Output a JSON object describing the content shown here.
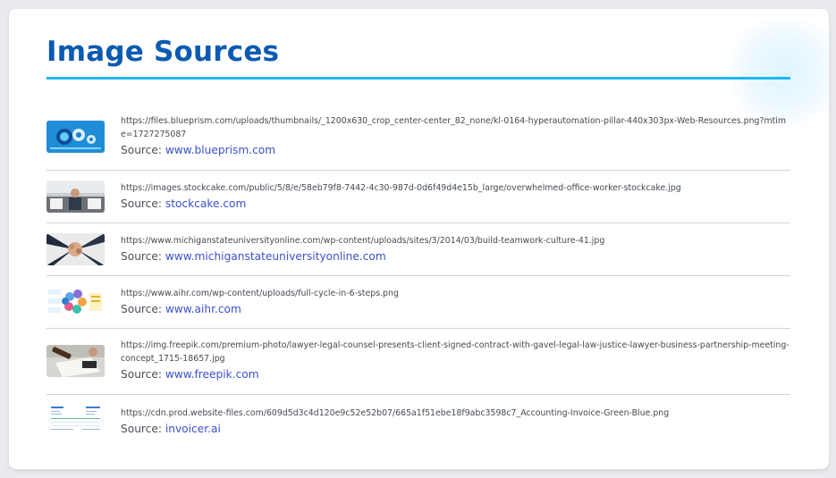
{
  "page": {
    "title": "Image Sources",
    "source_label": "Source:"
  },
  "colors": {
    "title": "#0b5ab2",
    "accent_rule": "#1fb8f0",
    "link": "#3a50d0"
  },
  "sources": [
    {
      "url": "https://files.blueprism.com/uploads/thumbnails/_1200x630_crop_center-center_82_none/kl-0164-hyperautomation-pillar-440x303px-Web-Resources.png?mtime=1727275087",
      "source": "www.blueprism.com",
      "thumb_icon": "gears-thumbnail"
    },
    {
      "url": "https://images.stockcake.com/public/5/8/e/58eb79f8-7442-4c30-987d-0d6f49d4e15b_large/overwhelmed-office-worker-stockcake.jpg",
      "source": "stockcake.com",
      "thumb_icon": "office-worker-thumbnail"
    },
    {
      "url": "https://www.michiganstateuniversityonline.com/wp-content/uploads/sites/3/2014/03/build-teamwork-culture-41.jpg",
      "source": "www.michiganstateuniversityonline.com",
      "thumb_icon": "teamwork-hands-thumbnail"
    },
    {
      "url": "https://www.aihr.com/wp-content/uploads/full-cycle-in-6-steps.png",
      "source": "www.aihr.com",
      "thumb_icon": "cycle-diagram-thumbnail"
    },
    {
      "url": "https://img.freepik.com/premium-photo/lawyer-legal-counsel-presents-client-signed-contract-with-gavel-legal-law-justice-lawyer-business-partnership-meeting-concept_1715-18657.jpg",
      "source": "www.freepik.com",
      "thumb_icon": "gavel-contract-thumbnail"
    },
    {
      "url": "https://cdn.prod.website-files.com/609d5d3c4d120e9c52e52b07/665a1f51ebe18f9abc3598c7_Accounting-Invoice-Green-Blue.png",
      "source": "invoicer.ai",
      "thumb_icon": "invoice-thumbnail"
    }
  ]
}
